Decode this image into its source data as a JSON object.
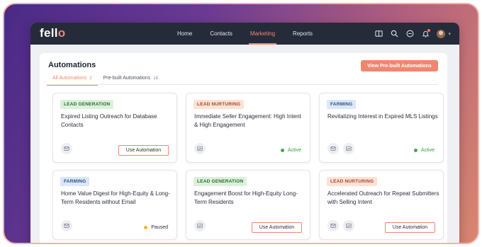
{
  "nav": {
    "logo_main": "fell",
    "logo_accent": "o",
    "links": [
      "Home",
      "Contacts",
      "Marketing",
      "Reports"
    ],
    "active": "Marketing",
    "icons": [
      "book-icon",
      "search-icon",
      "clock-icon",
      "bell-icon",
      "avatar",
      "chevron-down-icon"
    ]
  },
  "page": {
    "title": "Automations",
    "cta_label": "View Pre-built Automations",
    "tabs": [
      {
        "label": "All Automations",
        "count": "2"
      },
      {
        "label": "Pre-built Automations",
        "count": "18"
      }
    ]
  },
  "cards": [
    {
      "tag": "LEAD GENERATION",
      "title": "Expired Listing Outreach for Database Contacts",
      "icons": [
        "mail-icon"
      ],
      "action": "Use Automation"
    },
    {
      "tag": "LEAD NURTURING",
      "title": "Immediate Seller Engagement: High Intent & High Engagement",
      "icons": [
        "sms-icon"
      ],
      "status": "Active"
    },
    {
      "tag": "FARMING",
      "title": "Revitalizing Interest in Expired MLS Listings",
      "icons": [
        "mail-icon",
        "sms-icon"
      ],
      "status": "Active"
    },
    {
      "tag": "FARMING",
      "title": "Home Value Digest for High-Equity & Long-Term Residents without Email",
      "icons": [
        "mail-icon"
      ],
      "status": "Paused"
    },
    {
      "tag": "LEAD GENERATION",
      "title": "Engagement Boost for High-Equity Long-Term Residents",
      "icons": [
        "sms-icon"
      ],
      "action": "Use Automation"
    },
    {
      "tag": "LEAD NURTURING",
      "title": "Accelerated Outreach for Repeat Submitters with Selling Intent",
      "icons": [
        "mail-icon",
        "sms-icon"
      ],
      "action": "Use Automation"
    }
  ],
  "colors": {
    "accent": "#f08670",
    "nav_bg": "#262b3a",
    "active_status": "#44a845",
    "paused_status": "#f3b431"
  }
}
